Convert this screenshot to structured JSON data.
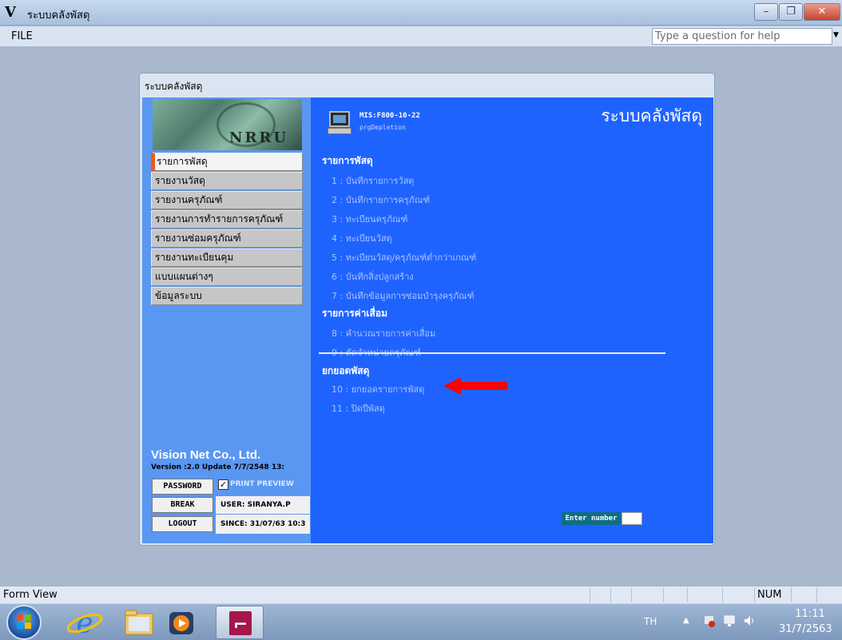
{
  "window": {
    "title": "ระบบคลังพัสดุ",
    "icon_label": "V",
    "controls": {
      "minimize": "–",
      "maximize": "❐",
      "close": "✕"
    }
  },
  "menubar": {
    "file": "FILE",
    "help_placeholder": "Type a question for help"
  },
  "form": {
    "title": "ระบบคลังพัสดุ",
    "logo_text": "NRRU",
    "nav": [
      {
        "label": "รายการพัสดุ",
        "active": true
      },
      {
        "label": "รายงานวัสดุ",
        "active": false
      },
      {
        "label": "รายงานครุภัณฑ์",
        "active": false
      },
      {
        "label": "รายงานการทำรายการครุภัณฑ์",
        "active": false
      },
      {
        "label": "รายงานซ่อมครุภัณฑ์",
        "active": false
      },
      {
        "label": "รายงานทะเบียนคุม",
        "active": false
      },
      {
        "label": "แบบแผนต่างๆ",
        "active": false
      },
      {
        "label": "ข้อมูลระบบ",
        "active": false
      }
    ],
    "company": "Vision Net Co., Ltd.",
    "version": "Version :2.0 Update 7/7/2548 13:",
    "buttons": {
      "password": "PASSWORD",
      "break": "BREAK",
      "logout": "LOGOUT"
    },
    "print_preview": {
      "checked": true,
      "mark": "✓",
      "label": "PRINT PREVIEW"
    },
    "user": "USER: SIRANYA.P",
    "since": "SINCE: 31/07/63 10:3",
    "header": {
      "code": "MIS:F800-10-22",
      "program": "prgDepletion",
      "title": "ระบบคลังพัสดุ"
    },
    "sections": [
      {
        "title": "รายการพัสดุ",
        "items": [
          "1 : บันทึกรายการวัสดุ",
          "2 : บันทึกรายการครุภัณฑ์",
          "3 : ทะเบียนครุภัณฑ์",
          "4 : ทะเบียนวัสดุ",
          "5 : ทะเบียนวัสดุ/ครุภัณฑ์ต่ำกว่าเกณฑ์",
          "6 : บันทึกสิ่งปลูกสร้าง",
          "7 : บันทึกข้อมูลการซ่อมบำรุงครุภัณฑ์"
        ]
      },
      {
        "title": "รายการค่าเสื่อม",
        "items": [
          "8 : คำนวณรายการค่าเสื่อม",
          "9 : ตัดจำหน่ายครุภัณฑ์"
        ]
      },
      {
        "title": "ยกยอดพัสดุ",
        "items": [
          "10 : ยกยอดรายการพัสดุ",
          "11 : ปิดปีพัสดุ"
        ]
      }
    ],
    "enter_number_label": "Enter number",
    "enter_number_value": ""
  },
  "statusbar": {
    "text": "Form View",
    "num": "NUM"
  },
  "taskbar": {
    "language": "TH",
    "time": "11:11",
    "date": "31/7/2563"
  },
  "colors": {
    "nav_active_accent": "#f05a14",
    "right_panel": "#1f63ff",
    "left_panel": "#5a97f2",
    "arrow": "#ff0000"
  }
}
